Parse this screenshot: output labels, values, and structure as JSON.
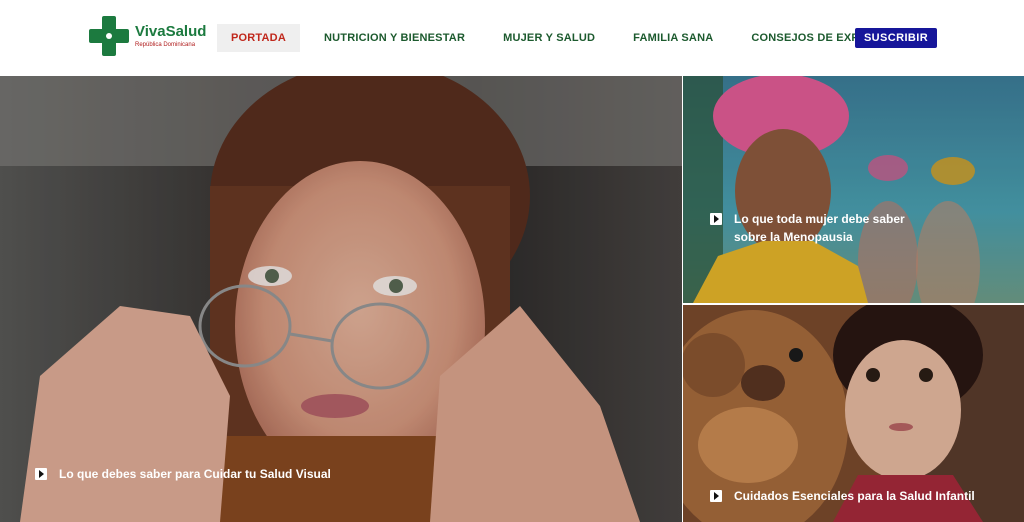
{
  "site": {
    "name": "VivaSalud",
    "subtitle": "República Dominicana"
  },
  "nav": {
    "items": [
      {
        "label": "PORTADA",
        "active": true
      },
      {
        "label": "NUTRICION Y BIENESTAR",
        "active": false
      },
      {
        "label": "MUJER Y SALUD",
        "active": false
      },
      {
        "label": "FAMILIA SANA",
        "active": false
      },
      {
        "label": "CONSEJOS DE EXPERTOS",
        "active": false
      }
    ],
    "subscribe_label": "SUSCRIBIR"
  },
  "articles": [
    {
      "title": "Lo que debes saber para Cuidar tu Salud Visual",
      "icon": "play-icon"
    },
    {
      "title": "Lo que toda mujer debe saber sobre la Menopausia",
      "icon": "play-icon"
    },
    {
      "title": "Cuidados Esenciales para la Salud Infantil",
      "icon": "play-icon"
    }
  ],
  "colors": {
    "brand_green": "#1c7a3f",
    "nav_text": "#1c5a2e",
    "active_red": "#c0281c",
    "subscribe_blue": "#16169a"
  }
}
